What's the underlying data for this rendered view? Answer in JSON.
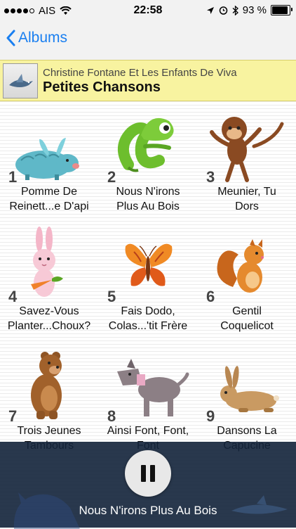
{
  "status_bar": {
    "carrier": "AIS",
    "time": "22:58",
    "battery": "93 %",
    "battery_level": 0.93
  },
  "nav": {
    "back_label": "Albums"
  },
  "album": {
    "artist": "Christine Fontane Et Les Enfants De Viva",
    "title": "Petites Chansons"
  },
  "tracks": [
    {
      "number": "1",
      "title": "Pomme De\nReinett...e D'api",
      "icon": "rabbit-icon"
    },
    {
      "number": "2",
      "title": "Nous N'irons\nPlus Au Bois",
      "icon": "chameleon-icon"
    },
    {
      "number": "3",
      "title": "Meunier, Tu\nDors",
      "icon": "monkey-icon"
    },
    {
      "number": "4",
      "title": "Savez-Vous\nPlanter...Choux?",
      "icon": "bunny-icon"
    },
    {
      "number": "5",
      "title": "Fais Dodo,\nColas...'tit Frère",
      "icon": "butterfly-icon"
    },
    {
      "number": "6",
      "title": "Gentil\nCoquelicot",
      "icon": "squirrel-icon"
    },
    {
      "number": "7",
      "title": "Trois Jeunes\nTambours",
      "icon": "bear-icon"
    },
    {
      "number": "8",
      "title": "Ainsi Font, Font,\nFont",
      "icon": "dog-icon"
    },
    {
      "number": "9",
      "title": "Dansons La\nCapucine",
      "icon": "hare-icon"
    }
  ],
  "player": {
    "now_playing": "Nous N'irons Plus Au Bois",
    "state_icon": "pause-icon"
  },
  "colors": {
    "accent": "#1a7ff0",
    "album_header_bg": "#f8f3a0",
    "player_bg": "#12223a"
  }
}
